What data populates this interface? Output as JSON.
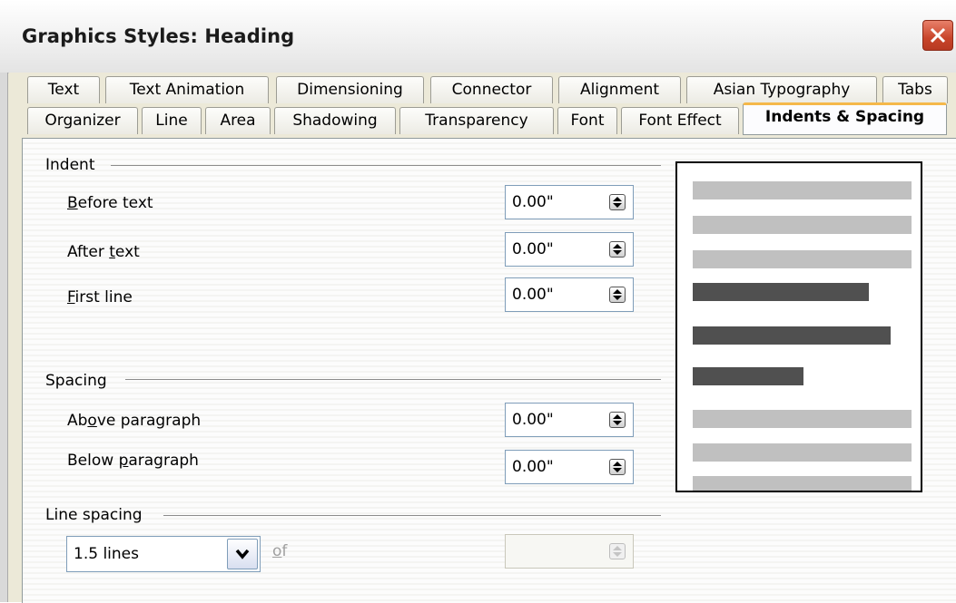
{
  "window": {
    "title": "Graphics Styles: Heading"
  },
  "tabs_row1": [
    "Text",
    "Text Animation",
    "Dimensioning",
    "Connector",
    "Alignment",
    "Asian Typography",
    "Tabs"
  ],
  "tabs_row2": [
    "Organizer",
    "Line",
    "Area",
    "Shadowing",
    "Transparency",
    "Font",
    "Font Effect",
    "Indents & Spacing"
  ],
  "active_tab": "Indents & Spacing",
  "indent": {
    "heading": "Indent",
    "before_text": {
      "label_pre": "",
      "label_mn": "B",
      "label_post": "efore text",
      "value": "0.00\""
    },
    "after_text": {
      "label_pre": "After ",
      "label_mn": "t",
      "label_post": "ext",
      "value": "0.00\""
    },
    "first_line": {
      "label_pre": "",
      "label_mn": "F",
      "label_post": "irst line",
      "value": "0.00\""
    }
  },
  "spacing": {
    "heading": "Spacing",
    "above": {
      "label_pre": "Ab",
      "label_mn": "o",
      "label_post": "ve paragraph",
      "value": "0.00\""
    },
    "below": {
      "label_pre": "Below ",
      "label_mn": "p",
      "label_post": "aragraph",
      "value": "0.00\""
    }
  },
  "line_spacing": {
    "heading": "Line spacing",
    "selected": "1.5 lines",
    "of_mn": "o",
    "of_post": "f",
    "of_value": ""
  },
  "colors": {
    "light_bar": "#c0c0c0",
    "dark_bar": "#505050",
    "active_tab_accent": "#f5b84a"
  }
}
